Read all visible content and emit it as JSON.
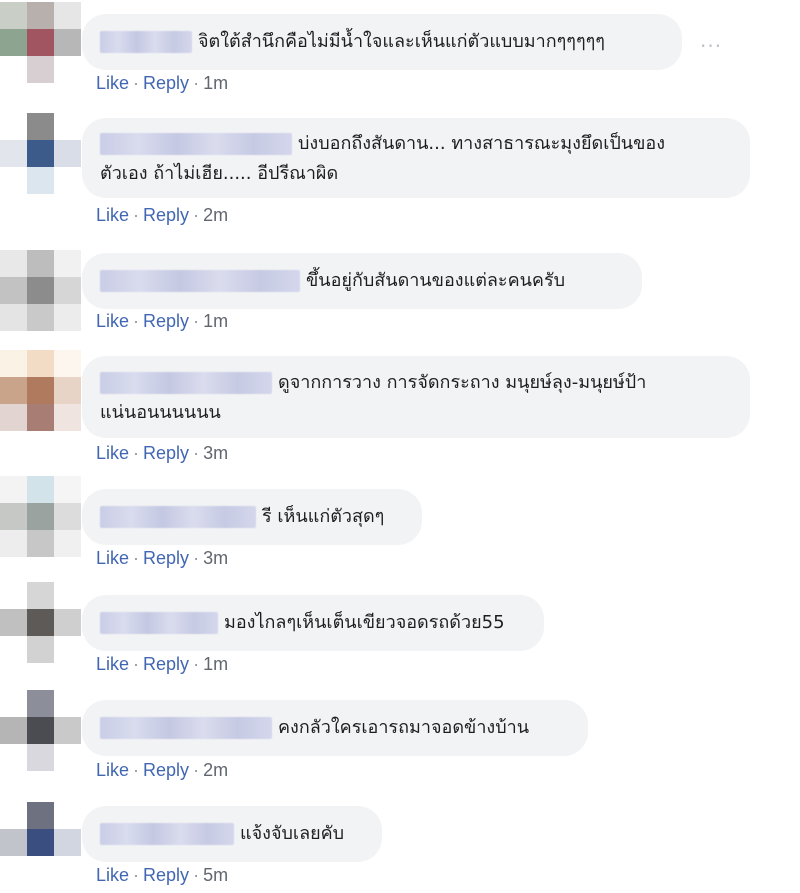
{
  "actions": {
    "like": "Like",
    "reply": "Reply",
    "separator": "·"
  },
  "more_glyph": "···",
  "comments": [
    {
      "text": "จิตใต้สำนึกคือไม่มีน้ำใจและเห็นแก่ตัวแบบมากๆๆๆๆๆ",
      "time": "1m"
    },
    {
      "text_line1": "บ่งบอกถึงสันดาน... ทางสาธารณะมุงยึดเป็นของ",
      "text_line2": "ตัวเอง ถ้าไม่เฮีย..... อีปรีณาผิด",
      "time": "2m"
    },
    {
      "text": "ขึ้นอยู่กับสันดานของแต่ละคนครับ",
      "time": "1m"
    },
    {
      "text_line1": "ดูจากการวาง การจัดกระถาง มนุยษ์ลุง-มนุยษ์ป้า",
      "text_line2": "แน่นอนนนนนน",
      "time": "3m"
    },
    {
      "text": "รี เห็นแก่ตัวสุดๆ",
      "time": "3m"
    },
    {
      "text": "มองไกลๆเห็นเต็นเขียวจอดรถด้วย55",
      "time": "1m"
    },
    {
      "text": "คงกลัวใครเอารถมาจอดข้างบ้าน",
      "time": "2m"
    },
    {
      "text": "แจ้งจับเลยคับ",
      "time": "5m"
    }
  ]
}
